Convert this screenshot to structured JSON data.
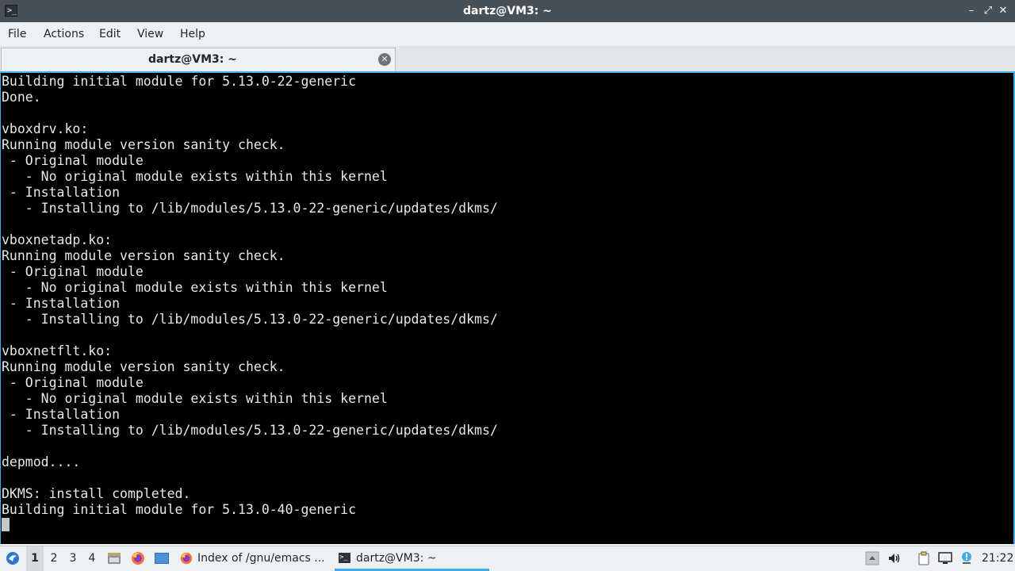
{
  "window": {
    "title": "dartz@VM3: ~",
    "app_icon": "terminal-icon",
    "buttons": {
      "minimize": "–",
      "maximize": "⤢",
      "close": "✕"
    }
  },
  "menu": {
    "items": [
      "File",
      "Actions",
      "Edit",
      "View",
      "Help"
    ]
  },
  "tab": {
    "label": "dartz@VM3: ~",
    "close_glyph": "✕"
  },
  "terminal": {
    "lines": [
      "Building initial module for 5.13.0-22-generic",
      "Done.",
      "",
      "vboxdrv.ko:",
      "Running module version sanity check.",
      " - Original module",
      "   - No original module exists within this kernel",
      " - Installation",
      "   - Installing to /lib/modules/5.13.0-22-generic/updates/dkms/",
      "",
      "vboxnetadp.ko:",
      "Running module version sanity check.",
      " - Original module",
      "   - No original module exists within this kernel",
      " - Installation",
      "   - Installing to /lib/modules/5.13.0-22-generic/updates/dkms/",
      "",
      "vboxnetflt.ko:",
      "Running module version sanity check.",
      " - Original module",
      "   - No original module exists within this kernel",
      " - Installation",
      "   - Installing to /lib/modules/5.13.0-22-generic/updates/dkms/",
      "",
      "depmod....",
      "",
      "DKMS: install completed.",
      "Building initial module for 5.13.0-40-generic"
    ],
    "text_color": "#e8e8e8",
    "background": "#000000",
    "focus_border": "#3daee9"
  },
  "taskbar": {
    "desktops": [
      "1",
      "2",
      "3",
      "4"
    ],
    "active_desktop": "1",
    "launchers": [
      "start-menu-icon",
      "file-manager-icon",
      "firefox-icon",
      "show-desktop-icon"
    ],
    "tasks": [
      {
        "label": "Index of /gnu/emacs ...",
        "icon": "firefox-icon"
      },
      {
        "label": "dartz@VM3: ~",
        "icon": "terminal-icon"
      }
    ],
    "tray": [
      "tray-expand-icon",
      "volume-icon",
      "clipboard-icon",
      "network-icon",
      "update-notifier-icon"
    ],
    "clock": "21:22"
  }
}
